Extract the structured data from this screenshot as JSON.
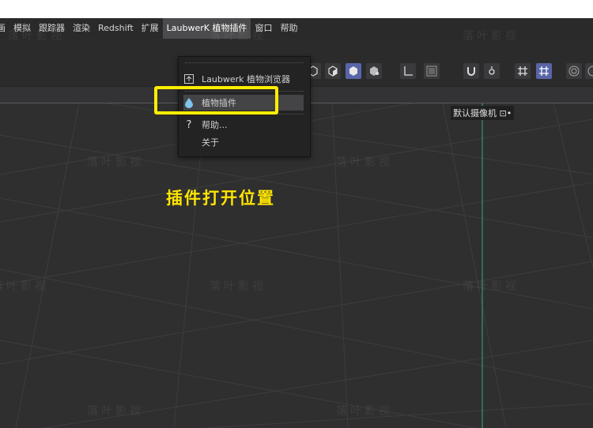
{
  "menubar": {
    "items": [
      "画",
      "模拟",
      "跟踪器",
      "渲染",
      "Redshift",
      "扩展",
      "LaubwerK 植物插件",
      "窗口",
      "帮助"
    ],
    "active_index": 6
  },
  "dropdown": {
    "browser_label": "Laubwerk 植物浏览器",
    "plugin_label": "植物插件",
    "help_label": "帮助...",
    "about_label": "关于"
  },
  "viewport": {
    "camera_label": "默认摄像机 ⊡•"
  },
  "annotation": {
    "text": "插件打开位置",
    "color": "#ffe500"
  },
  "watermark": {
    "text": "落叶影视"
  },
  "colors": {
    "accent_selected": "#5865a8",
    "highlight_box": "#ffee00",
    "axis_line": "#3fa878"
  }
}
